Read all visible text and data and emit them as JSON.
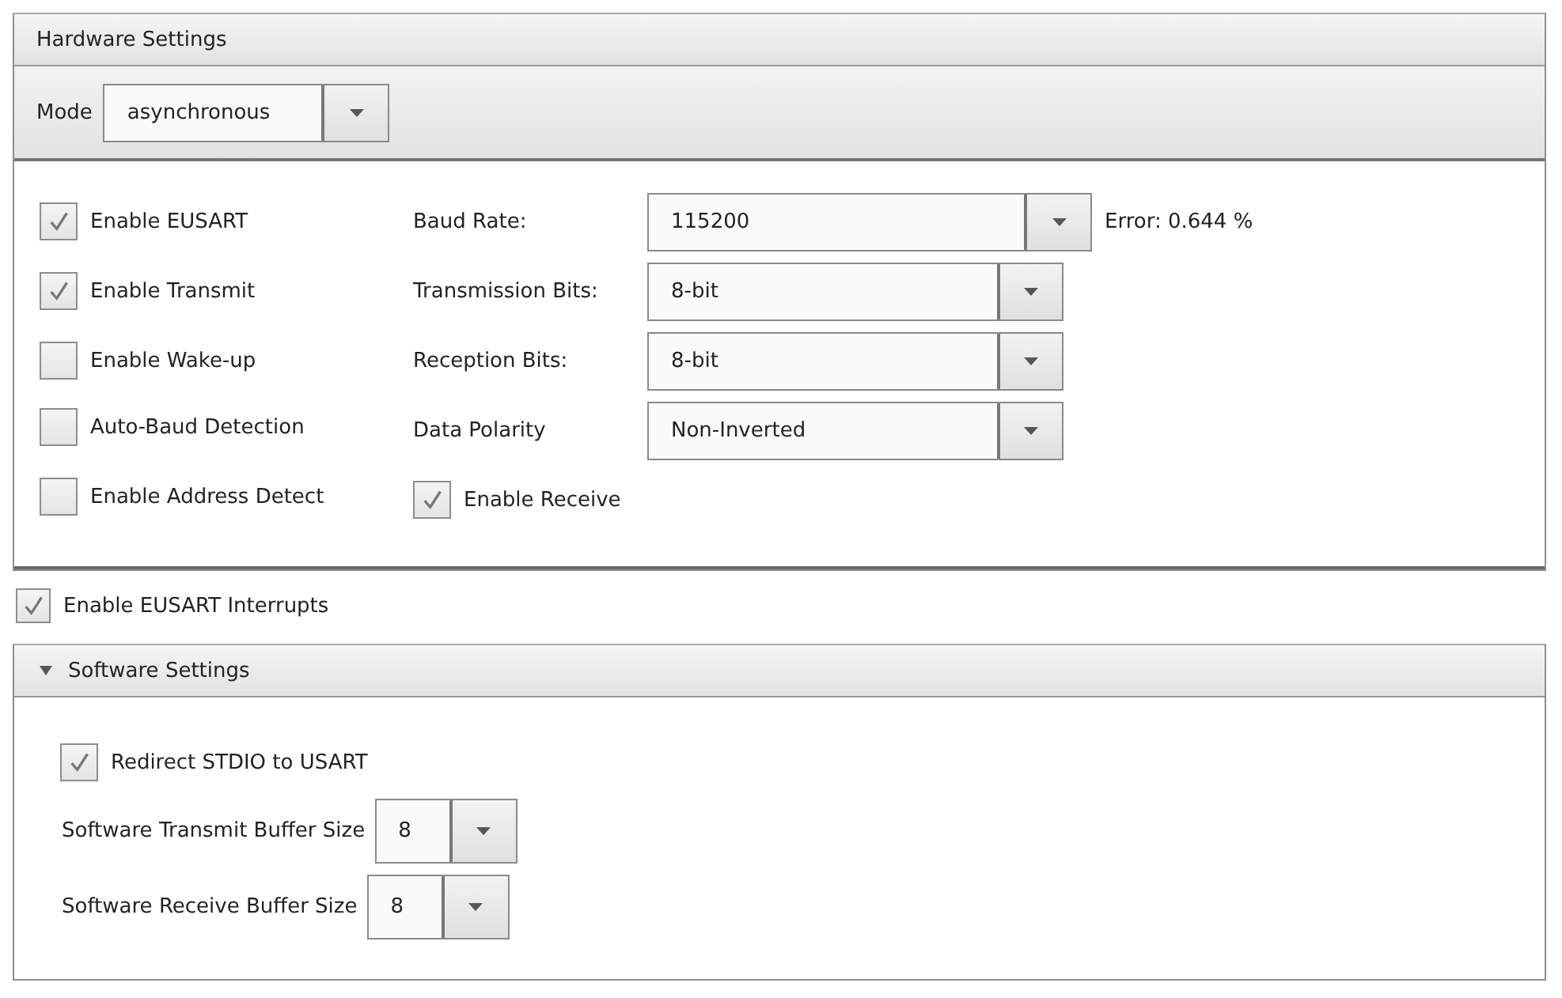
{
  "hardware_settings": {
    "title": "Hardware Settings",
    "mode": {
      "label": "Mode",
      "value": "asynchronous"
    },
    "options": [
      {
        "label": "Enable EUSART",
        "checked": true
      },
      {
        "label": "Enable Transmit",
        "checked": true
      },
      {
        "label": "Enable Wake-up",
        "checked": false
      },
      {
        "label": "Auto-Baud Detection",
        "checked": false
      },
      {
        "label": "Enable Address Detect",
        "checked": false
      }
    ],
    "fields": [
      {
        "label": "Baud Rate:",
        "value": "115200",
        "note": "Error: 0.644 %"
      },
      {
        "label": "Transmission Bits:",
        "value": "8-bit"
      },
      {
        "label": "Reception Bits:",
        "value": "8-bit"
      },
      {
        "label": "Data Polarity",
        "value": "Non-Inverted"
      }
    ],
    "enable_receive": {
      "label": "Enable Receive",
      "checked": true
    }
  },
  "interrupts": {
    "label": "Enable EUSART Interrupts",
    "checked": true
  },
  "software_settings": {
    "title": "Software Settings",
    "expanded": true,
    "redirect": {
      "label": "Redirect STDIO to USART",
      "checked": true
    },
    "buffers": [
      {
        "label": "Software Transmit Buffer Size",
        "value": "8"
      },
      {
        "label": "Software Receive Buffer Size",
        "value": "8"
      }
    ]
  }
}
